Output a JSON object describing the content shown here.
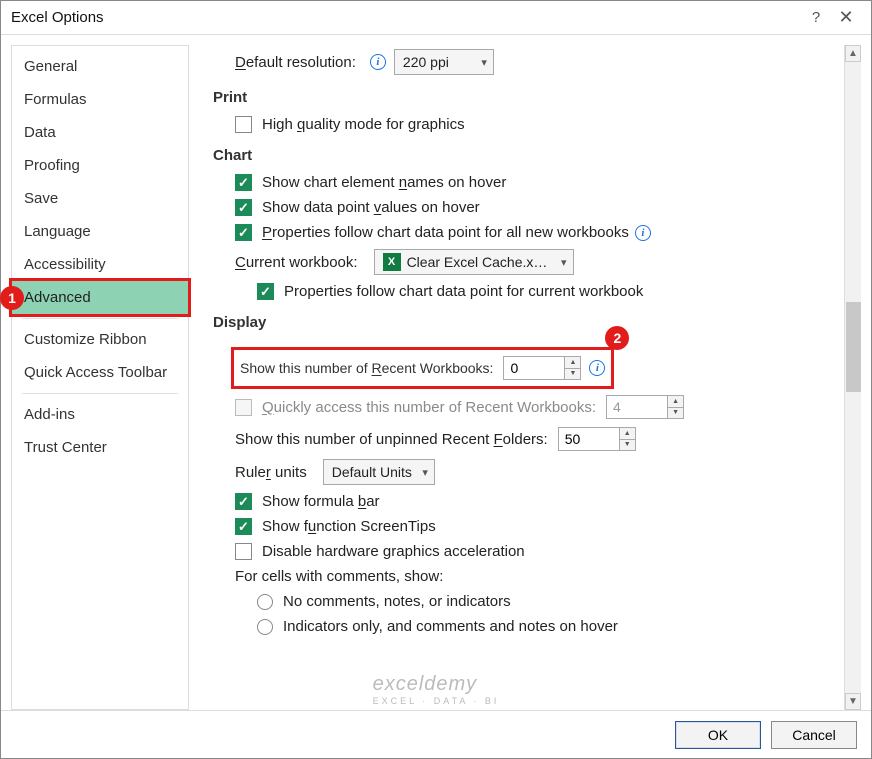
{
  "window": {
    "title": "Excel Options",
    "help": "?",
    "close": "✕"
  },
  "sidebar": {
    "groups": [
      [
        "General",
        "Formulas",
        "Data",
        "Proofing",
        "Save",
        "Language",
        "Accessibility",
        "Advanced"
      ],
      [
        "Customize Ribbon",
        "Quick Access Toolbar"
      ],
      [
        "Add-ins",
        "Trust Center"
      ]
    ],
    "selected": "Advanced"
  },
  "top": {
    "default_resolution_label": "Default resolution:",
    "default_resolution_value": "220 ppi"
  },
  "sections": {
    "print": {
      "title": "Print",
      "high_quality": "High quality mode for graphics"
    },
    "chart": {
      "title": "Chart",
      "show_element_names": "Show chart element names on hover",
      "show_data_values": "Show data point values on hover",
      "properties_new": "Properties follow chart data point for all new workbooks",
      "current_wb_label": "Current workbook:",
      "current_wb_value": "Clear Excel Cache.x…",
      "properties_current": "Properties follow chart data point for current workbook"
    },
    "display": {
      "title": "Display",
      "recent_wb_label": "Show this number of Recent Workbooks:",
      "recent_wb_value": "0",
      "quick_access_label": "Quickly access this number of Recent Workbooks:",
      "quick_access_value": "4",
      "recent_folders_label": "Show this number of unpinned Recent Folders:",
      "recent_folders_value": "50",
      "ruler_label": "Ruler units",
      "ruler_value": "Default Units",
      "show_formula_bar": "Show formula bar",
      "show_screentips": "Show function ScreenTips",
      "disable_hw": "Disable hardware graphics acceleration",
      "comments_intro": "For cells with comments, show:",
      "comments_opt1": "No comments, notes, or indicators",
      "comments_opt2": "Indicators only, and comments and notes on hover"
    }
  },
  "footer": {
    "ok": "OK",
    "cancel": "Cancel"
  },
  "watermark": {
    "brand": "exceldemy",
    "tag": "EXCEL · DATA · BI"
  },
  "callouts": {
    "one": "1",
    "two": "2"
  }
}
